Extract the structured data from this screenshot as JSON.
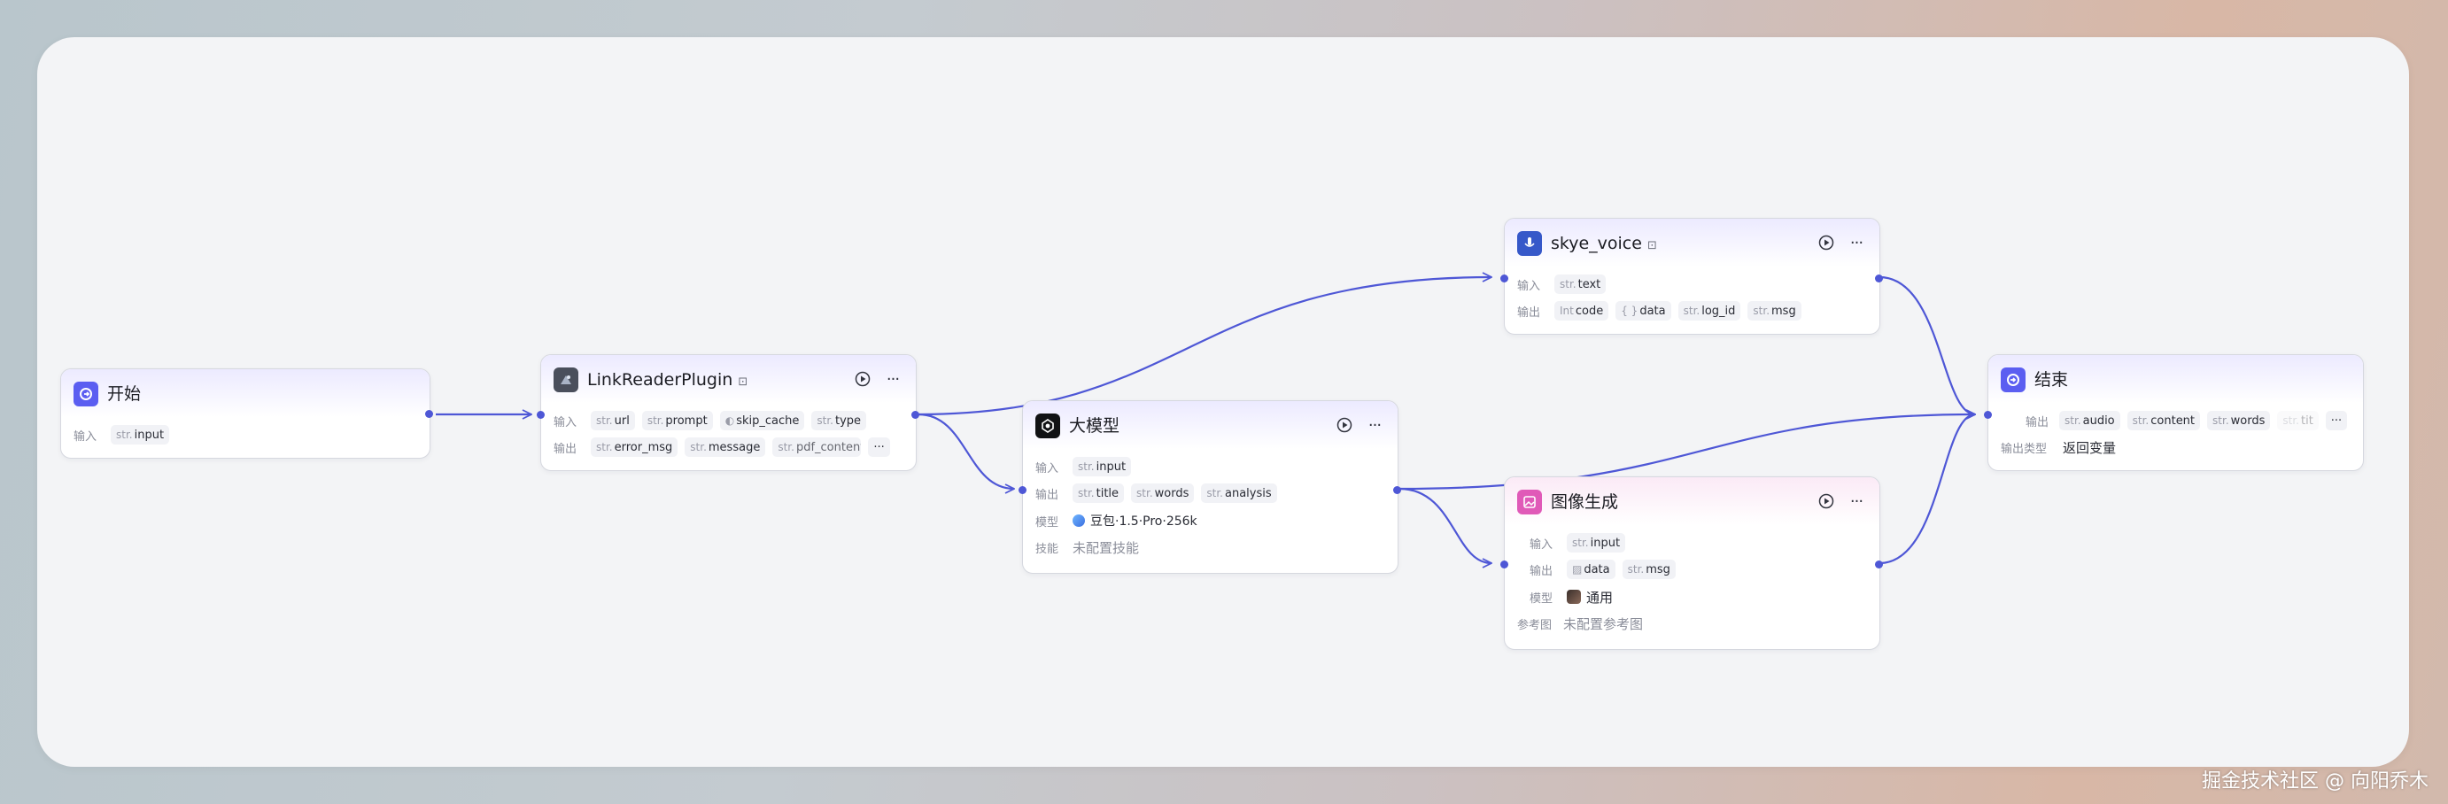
{
  "colors": {
    "edge": "#4e57d6",
    "accent": "#5b5ef1",
    "pink": "#e05ab8"
  },
  "labels": {
    "input": "输入",
    "output": "输出",
    "model": "模型",
    "skill": "技能",
    "ref": "参考图",
    "output_type": "输出类型"
  },
  "nodes": {
    "start": {
      "title": "开始",
      "icon": "start-icon",
      "inputs": [
        {
          "type": "str.",
          "name": "input"
        }
      ]
    },
    "link": {
      "title": "LinkReaderPlugin",
      "icon": "plugin-icon",
      "inputs": [
        {
          "type": "str.",
          "name": "url"
        },
        {
          "type": "str.",
          "name": "prompt"
        },
        {
          "type": "toggle",
          "name": "skip_cache"
        },
        {
          "type": "str.",
          "name": "type"
        }
      ],
      "outputs": [
        {
          "type": "str.",
          "name": "error_msg"
        },
        {
          "type": "str.",
          "name": "message"
        },
        {
          "type": "str.",
          "name": "pdf_content"
        }
      ],
      "more": "···"
    },
    "llm": {
      "title": "大模型",
      "icon": "llm-icon",
      "inputs": [
        {
          "type": "str.",
          "name": "input"
        }
      ],
      "outputs": [
        {
          "type": "str.",
          "name": "title"
        },
        {
          "type": "str.",
          "name": "words"
        },
        {
          "type": "str.",
          "name": "analysis"
        }
      ],
      "model": "豆包·1.5·Pro·256k",
      "skill": "未配置技能"
    },
    "voice": {
      "title": "skye_voice",
      "icon": "voice-plugin-icon",
      "inputs": [
        {
          "type": "str.",
          "name": "text"
        }
      ],
      "outputs": [
        {
          "type": "Int",
          "name": "code"
        },
        {
          "type": "{ }",
          "name": "data"
        },
        {
          "type": "str.",
          "name": "log_id"
        },
        {
          "type": "str.",
          "name": "msg"
        }
      ]
    },
    "image": {
      "title": "图像生成",
      "icon": "image-gen-icon",
      "inputs": [
        {
          "type": "str.",
          "name": "input"
        }
      ],
      "outputs": [
        {
          "type": "img",
          "name": "data"
        },
        {
          "type": "str.",
          "name": "msg"
        }
      ],
      "model": "通用",
      "ref": "未配置参考图"
    },
    "end": {
      "title": "结束",
      "icon": "end-icon",
      "outputs": [
        {
          "type": "str.",
          "name": "audio"
        },
        {
          "type": "str.",
          "name": "content"
        },
        {
          "type": "str.",
          "name": "words"
        },
        {
          "type": "str.",
          "name": "tit"
        }
      ],
      "more": "···",
      "output_type": "返回变量"
    }
  },
  "watermark": "掘金技术社区 @ 向阳乔木"
}
